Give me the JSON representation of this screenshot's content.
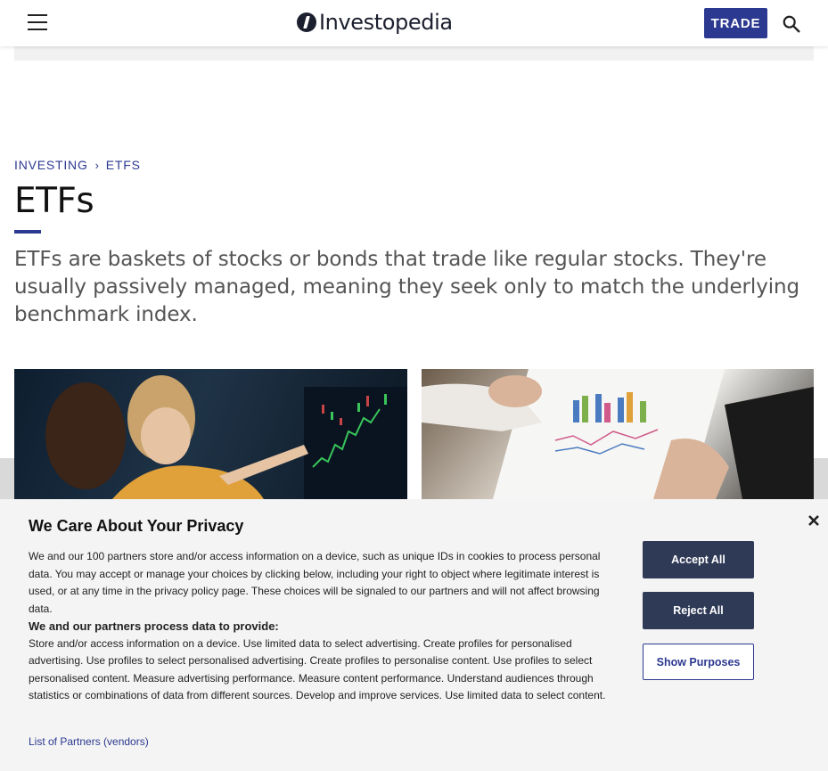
{
  "header": {
    "logo_text": "Investopedia",
    "trade_label": "TRADE",
    "brand_color": "#2c3990"
  },
  "breadcrumb": {
    "items": [
      "INVESTING",
      "ETFS"
    ],
    "separator": "›"
  },
  "page": {
    "title": "ETFs",
    "intro": "ETFs are baskets of stocks or bonds that trade like regular stocks. They're usually passively managed, meaning they seek only to match the underlying benchmark index."
  },
  "consent": {
    "title": "We Care About Your Privacy",
    "body": "We and our 100 partners store and/or access information on a device, such as unique IDs in cookies to process personal data. You may accept or manage your choices by clicking below, including your right to object where legitimate interest is used, or at any time in the privacy policy page. These choices will be signaled to our partners and will not affect browsing data.",
    "subhead": "We and our partners process data to provide:",
    "purposes": "Store and/or access information on a device. Use limited data to select advertising. Create profiles for personalised advertising. Use profiles to select personalised advertising. Create profiles to personalise content. Use profiles to select personalised content. Measure advertising performance. Measure content performance. Understand audiences through statistics or combinations of data from different sources. Develop and improve services. Use limited data to select content.",
    "partners_link": "List of Partners (vendors)",
    "accept_label": "Accept All",
    "reject_label": "Reject All",
    "show_purposes_label": "Show Purposes"
  }
}
